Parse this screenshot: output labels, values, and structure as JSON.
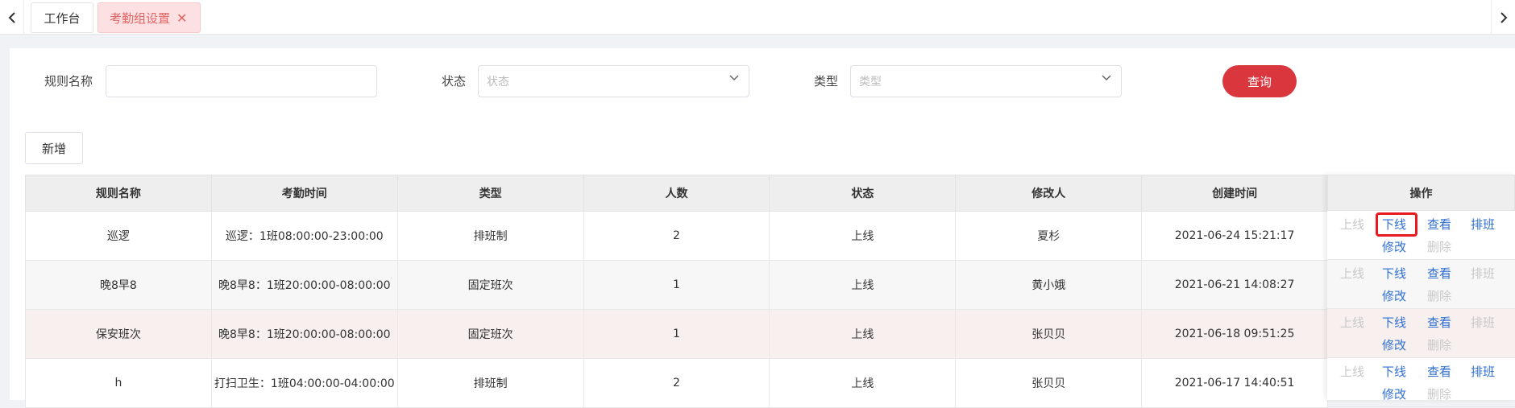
{
  "tabs": {
    "home": "工作台",
    "active": "考勤组设置",
    "close": "✕"
  },
  "filters": {
    "rule_name_label": "规则名称",
    "rule_name_value": "",
    "status_label": "状态",
    "status_placeholder": "状态",
    "type_label": "类型",
    "type_placeholder": "类型",
    "query_button": "查询"
  },
  "add_button": "新增",
  "table": {
    "headers": [
      "规则名称",
      "考勤时间",
      "类型",
      "人数",
      "状态",
      "修改人",
      "创建时间"
    ],
    "ops_header": "操作",
    "rows": [
      [
        "巡逻",
        "巡逻：1班08:00:00-23:00:00",
        "排班制",
        "2",
        "上线",
        "夏杉",
        "2021-06-24 15:21:17"
      ],
      [
        "晚8早8",
        "晚8早8：1班20:00:00-08:00:00",
        "固定班次",
        "1",
        "上线",
        "黄小娥",
        "2021-06-21 14:08:27"
      ],
      [
        "保安班次",
        "晚8早8：1班20:00:00-08:00:00",
        "固定班次",
        "1",
        "上线",
        "张贝贝",
        "2021-06-18 09:51:25"
      ],
      [
        "h",
        "打扫卫生：1班04:00:00-04:00:00",
        "排班制",
        "2",
        "上线",
        "张贝贝",
        "2021-06-17 14:40:51"
      ]
    ],
    "ops": {
      "online": "上线",
      "offline": "下线",
      "view": "查看",
      "schedule": "排班",
      "edit": "修改",
      "delete": "删除"
    }
  },
  "colors": {
    "primary": "#d9363e",
    "link": "#2f6fd4",
    "disabled": "#c8c8c8",
    "highlight": "#e8191f"
  }
}
